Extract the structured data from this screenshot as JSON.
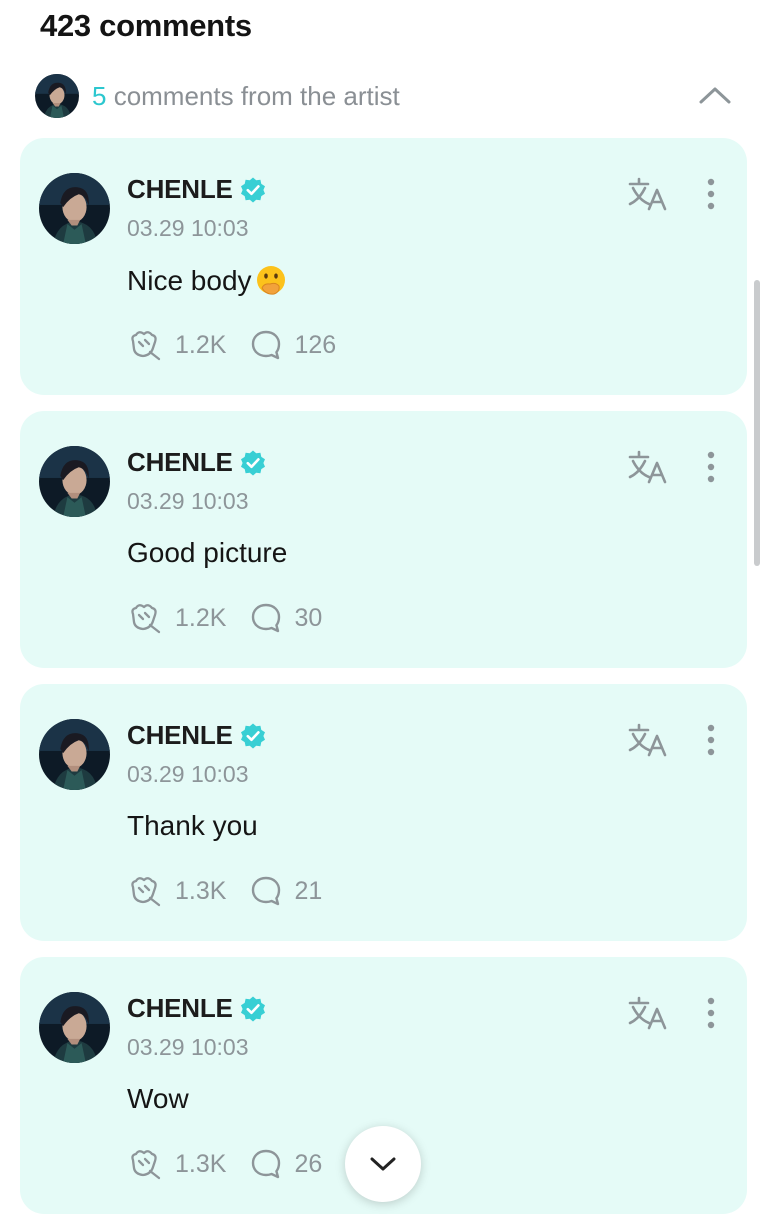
{
  "header": {
    "title": "423 comments"
  },
  "artist_section": {
    "count": "5",
    "label": " comments from the artist"
  },
  "colors": {
    "accent": "#2cc7cf",
    "card_background": "#e5fbf7",
    "muted_text": "#8d9599"
  },
  "icons": {
    "collapse": "chevron-up-icon",
    "verified": "verified-badge-icon",
    "translate": "translate-icon",
    "more": "more-vertical-icon",
    "like": "heart-hands-icon",
    "reply": "speech-bubble-icon",
    "scroll": "chevron-down-icon"
  },
  "comments": [
    {
      "author": "CHENLE",
      "timestamp": "03.29 10:03",
      "text": "Nice body",
      "emoji": "face-with-hand-over-mouth",
      "likes": "1.2K",
      "replies": "126"
    },
    {
      "author": "CHENLE",
      "timestamp": "03.29 10:03",
      "text": "Good picture",
      "likes": "1.2K",
      "replies": "30"
    },
    {
      "author": "CHENLE",
      "timestamp": "03.29 10:03",
      "text": "Thank you",
      "likes": "1.3K",
      "replies": "21"
    },
    {
      "author": "CHENLE",
      "timestamp": "03.29 10:03",
      "text": "Wow",
      "likes": "1.3K",
      "replies": "26"
    }
  ]
}
